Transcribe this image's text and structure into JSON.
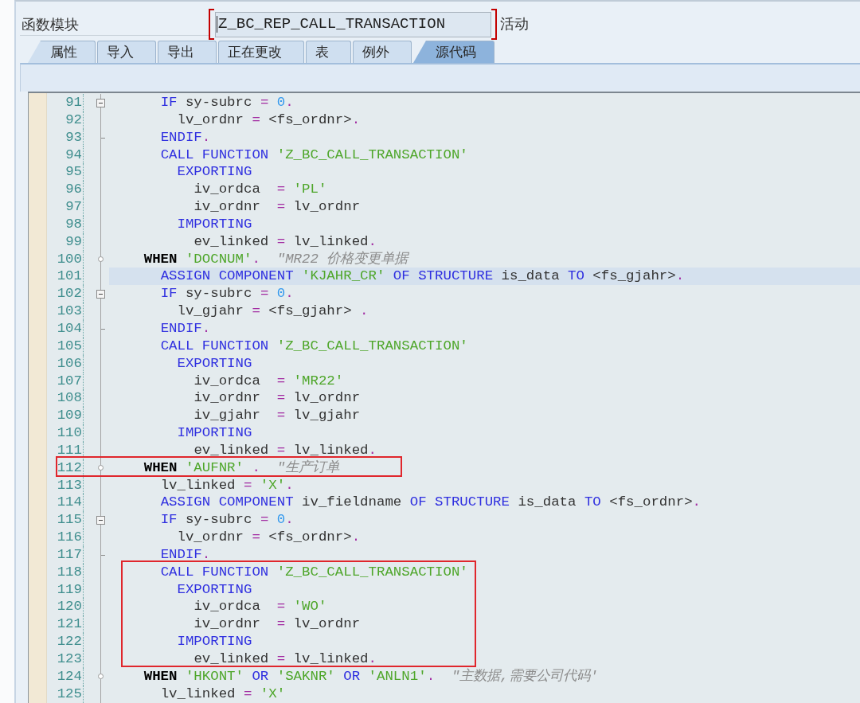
{
  "header": {
    "label": "函数模块",
    "field_value": "Z_BC_REP_CALL_TRANSACTION",
    "status": "活动"
  },
  "tabs": [
    {
      "label": "属性",
      "selected": false
    },
    {
      "label": "导入",
      "selected": false
    },
    {
      "label": "导出",
      "selected": false
    },
    {
      "label": "正在更改",
      "selected": false
    },
    {
      "label": "表",
      "selected": false
    },
    {
      "label": "例外",
      "selected": false
    },
    {
      "label": "源代码",
      "selected": true
    }
  ],
  "editor": {
    "blocks": [
      {
        "framed": false,
        "lines": [
          {
            "number": "91",
            "kind": "fold-start",
            "selected": false,
            "tokens": [
              {
                "kind": "keyword",
                "text": "      IF"
              },
              {
                "kind": "plain",
                "text": " sy-subrc "
              },
              {
                "kind": "operator",
                "text": "="
              },
              {
                "kind": "number",
                "text": " 0"
              },
              {
                "kind": "operator",
                "text": "."
              }
            ]
          },
          {
            "number": "92",
            "kind": "plain",
            "selected": false,
            "tokens": [
              {
                "kind": "plain",
                "text": "        lv_ordnr "
              },
              {
                "kind": "operator",
                "text": "="
              },
              {
                "kind": "plain",
                "text": " <fs_ordnr>"
              },
              {
                "kind": "operator",
                "text": "."
              }
            ]
          },
          {
            "number": "93",
            "kind": "fold-end",
            "selected": false,
            "tokens": [
              {
                "kind": "keyword",
                "text": "      ENDIF"
              },
              {
                "kind": "operator",
                "text": "."
              }
            ]
          },
          {
            "number": "94",
            "kind": "plain",
            "selected": false,
            "tokens": [
              {
                "kind": "keyword",
                "text": "      CALL FUNCTION"
              },
              {
                "kind": "string",
                "text": " 'Z_BC_CALL_TRANSACTION'"
              }
            ]
          },
          {
            "number": "95",
            "kind": "plain",
            "selected": false,
            "tokens": [
              {
                "kind": "keyword",
                "text": "        EXPORTING"
              }
            ]
          },
          {
            "number": "96",
            "kind": "plain",
            "selected": false,
            "tokens": [
              {
                "kind": "plain",
                "text": "          iv_ordca  "
              },
              {
                "kind": "operator",
                "text": "="
              },
              {
                "kind": "string",
                "text": " 'PL'"
              }
            ]
          },
          {
            "number": "97",
            "kind": "plain",
            "selected": false,
            "tokens": [
              {
                "kind": "plain",
                "text": "          iv_ordnr  "
              },
              {
                "kind": "operator",
                "text": "="
              },
              {
                "kind": "plain",
                "text": " lv_ordnr"
              }
            ]
          },
          {
            "number": "98",
            "kind": "plain",
            "selected": false,
            "tokens": [
              {
                "kind": "keyword",
                "text": "        IMPORTING"
              }
            ]
          },
          {
            "number": "99",
            "kind": "plain",
            "selected": false,
            "tokens": [
              {
                "kind": "plain",
                "text": "          ev_linked "
              },
              {
                "kind": "operator",
                "text": "="
              },
              {
                "kind": "plain",
                "text": " lv_linked"
              },
              {
                "kind": "operator",
                "text": "."
              }
            ]
          },
          {
            "number": "100",
            "kind": "branch",
            "selected": false,
            "tokens": [
              {
                "kind": "control",
                "text": "    WHEN"
              },
              {
                "kind": "string",
                "text": " 'DOCNUM'"
              },
              {
                "kind": "operator",
                "text": "."
              },
              {
                "kind": "comment",
                "text": "  \"MR22 价格变更单据"
              }
            ]
          },
          {
            "number": "101",
            "kind": "plain",
            "selected": true,
            "tokens": [
              {
                "kind": "keyword",
                "text": "      ASSIGN COMPONENT"
              },
              {
                "kind": "string",
                "text": " 'KJAHR_CR'"
              },
              {
                "kind": "keyword",
                "text": " OF STRUCTURE"
              },
              {
                "kind": "plain",
                "text": " is_data "
              },
              {
                "kind": "keyword",
                "text": "TO"
              },
              {
                "kind": "plain",
                "text": " <fs_gjahr>"
              },
              {
                "kind": "operator",
                "text": "."
              }
            ]
          },
          {
            "number": "102",
            "kind": "fold-start",
            "selected": false,
            "tokens": [
              {
                "kind": "keyword",
                "text": "      IF"
              },
              {
                "kind": "plain",
                "text": " sy-subrc "
              },
              {
                "kind": "operator",
                "text": "="
              },
              {
                "kind": "number",
                "text": " 0"
              },
              {
                "kind": "operator",
                "text": "."
              }
            ]
          },
          {
            "number": "103",
            "kind": "plain",
            "selected": false,
            "tokens": [
              {
                "kind": "plain",
                "text": "        lv_gjahr "
              },
              {
                "kind": "operator",
                "text": "="
              },
              {
                "kind": "plain",
                "text": " <fs_gjahr> "
              },
              {
                "kind": "operator",
                "text": "."
              }
            ]
          },
          {
            "number": "104",
            "kind": "fold-end",
            "selected": false,
            "tokens": [
              {
                "kind": "keyword",
                "text": "      ENDIF"
              },
              {
                "kind": "operator",
                "text": "."
              }
            ]
          },
          {
            "number": "105",
            "kind": "plain",
            "selected": false,
            "tokens": [
              {
                "kind": "keyword",
                "text": "      CALL FUNCTION"
              },
              {
                "kind": "string",
                "text": " 'Z_BC_CALL_TRANSACTION'"
              }
            ]
          },
          {
            "number": "106",
            "kind": "plain",
            "selected": false,
            "tokens": [
              {
                "kind": "keyword",
                "text": "        EXPORTING"
              }
            ]
          },
          {
            "number": "107",
            "kind": "plain",
            "selected": false,
            "tokens": [
              {
                "kind": "plain",
                "text": "          iv_ordca  "
              },
              {
                "kind": "operator",
                "text": "="
              },
              {
                "kind": "string",
                "text": " 'MR22'"
              }
            ]
          },
          {
            "number": "108",
            "kind": "plain",
            "selected": false,
            "tokens": [
              {
                "kind": "plain",
                "text": "          iv_ordnr  "
              },
              {
                "kind": "operator",
                "text": "="
              },
              {
                "kind": "plain",
                "text": " lv_ordnr"
              }
            ]
          },
          {
            "number": "109",
            "kind": "plain",
            "selected": false,
            "tokens": [
              {
                "kind": "plain",
                "text": "          iv_gjahr  "
              },
              {
                "kind": "operator",
                "text": "="
              },
              {
                "kind": "plain",
                "text": " lv_gjahr"
              }
            ]
          },
          {
            "number": "110",
            "kind": "plain",
            "selected": false,
            "tokens": [
              {
                "kind": "keyword",
                "text": "        IMPORTING"
              }
            ]
          },
          {
            "number": "111",
            "kind": "plain",
            "selected": false,
            "tokens": [
              {
                "kind": "plain",
                "text": "          ev_linked "
              },
              {
                "kind": "operator",
                "text": "="
              },
              {
                "kind": "plain",
                "text": " lv_linked"
              },
              {
                "kind": "operator",
                "text": "."
              }
            ]
          }
        ]
      },
      {
        "framed": true,
        "lines": [
          {
            "number": "112",
            "kind": "branch",
            "selected": false,
            "tokens": [
              {
                "kind": "control",
                "text": "    WHEN"
              },
              {
                "kind": "string",
                "text": " 'AUFNR'"
              },
              {
                "kind": "operator",
                "text": " ."
              },
              {
                "kind": "comment",
                "text": "  \"生产订单"
              }
            ]
          }
        ]
      },
      {
        "framed": false,
        "lines": [
          {
            "number": "113",
            "kind": "plain",
            "selected": false,
            "tokens": [
              {
                "kind": "plain",
                "text": "      lv_linked "
              },
              {
                "kind": "operator",
                "text": "="
              },
              {
                "kind": "string",
                "text": " 'X'"
              },
              {
                "kind": "operator",
                "text": "."
              }
            ]
          },
          {
            "number": "114",
            "kind": "plain",
            "selected": false,
            "tokens": [
              {
                "kind": "keyword",
                "text": "      ASSIGN COMPONENT"
              },
              {
                "kind": "plain",
                "text": " iv_fieldname "
              },
              {
                "kind": "keyword",
                "text": "OF STRUCTURE"
              },
              {
                "kind": "plain",
                "text": " is_data "
              },
              {
                "kind": "keyword",
                "text": "TO"
              },
              {
                "kind": "plain",
                "text": " <fs_ordnr>"
              },
              {
                "kind": "operator",
                "text": "."
              }
            ]
          },
          {
            "number": "115",
            "kind": "fold-start",
            "selected": false,
            "tokens": [
              {
                "kind": "keyword",
                "text": "      IF"
              },
              {
                "kind": "plain",
                "text": " sy-subrc "
              },
              {
                "kind": "operator",
                "text": "="
              },
              {
                "kind": "number",
                "text": " 0"
              },
              {
                "kind": "operator",
                "text": "."
              }
            ]
          },
          {
            "number": "116",
            "kind": "plain",
            "selected": false,
            "tokens": [
              {
                "kind": "plain",
                "text": "        lv_ordnr "
              },
              {
                "kind": "operator",
                "text": "="
              },
              {
                "kind": "plain",
                "text": " <fs_ordnr>"
              },
              {
                "kind": "operator",
                "text": "."
              }
            ]
          },
          {
            "number": "117",
            "kind": "fold-end",
            "selected": false,
            "tokens": [
              {
                "kind": "keyword",
                "text": "      ENDIF"
              },
              {
                "kind": "operator",
                "text": "."
              }
            ]
          }
        ]
      },
      {
        "framed": true,
        "lines": [
          {
            "number": "118",
            "kind": "plain",
            "selected": false,
            "tokens": [
              {
                "kind": "keyword",
                "text": "      CALL FUNCTION"
              },
              {
                "kind": "string",
                "text": " 'Z_BC_CALL_TRANSACTION'"
              }
            ]
          },
          {
            "number": "119",
            "kind": "plain",
            "selected": false,
            "tokens": [
              {
                "kind": "keyword",
                "text": "        EXPORTING"
              }
            ]
          },
          {
            "number": "120",
            "kind": "plain",
            "selected": false,
            "tokens": [
              {
                "kind": "plain",
                "text": "          iv_ordca  "
              },
              {
                "kind": "operator",
                "text": "="
              },
              {
                "kind": "string",
                "text": " 'WO'"
              }
            ]
          },
          {
            "number": "121",
            "kind": "plain",
            "selected": false,
            "tokens": [
              {
                "kind": "plain",
                "text": "          iv_ordnr  "
              },
              {
                "kind": "operator",
                "text": "="
              },
              {
                "kind": "plain",
                "text": " lv_ordnr"
              }
            ]
          },
          {
            "number": "122",
            "kind": "plain",
            "selected": false,
            "tokens": [
              {
                "kind": "keyword",
                "text": "        IMPORTING"
              }
            ]
          },
          {
            "number": "123",
            "kind": "plain",
            "selected": false,
            "tokens": [
              {
                "kind": "plain",
                "text": "          ev_linked "
              },
              {
                "kind": "operator",
                "text": "="
              },
              {
                "kind": "plain",
                "text": " lv_linked"
              },
              {
                "kind": "operator",
                "text": "."
              }
            ]
          }
        ]
      },
      {
        "framed": false,
        "lines": [
          {
            "number": "124",
            "kind": "branch",
            "selected": false,
            "tokens": [
              {
                "kind": "control",
                "text": "    WHEN"
              },
              {
                "kind": "string",
                "text": " 'HKONT'"
              },
              {
                "kind": "keyword",
                "text": " OR"
              },
              {
                "kind": "string",
                "text": " 'SAKNR'"
              },
              {
                "kind": "keyword",
                "text": " OR"
              },
              {
                "kind": "string",
                "text": " 'ANLN1'"
              },
              {
                "kind": "operator",
                "text": "."
              },
              {
                "kind": "comment",
                "text": "  \"主数据,需要公司代码'"
              }
            ]
          },
          {
            "number": "125",
            "kind": "plain",
            "selected": false,
            "tokens": [
              {
                "kind": "plain",
                "text": "      lv_linked "
              },
              {
                "kind": "operator",
                "text": "="
              },
              {
                "kind": "string",
                "text": " 'X'"
              }
            ]
          }
        ]
      }
    ]
  }
}
